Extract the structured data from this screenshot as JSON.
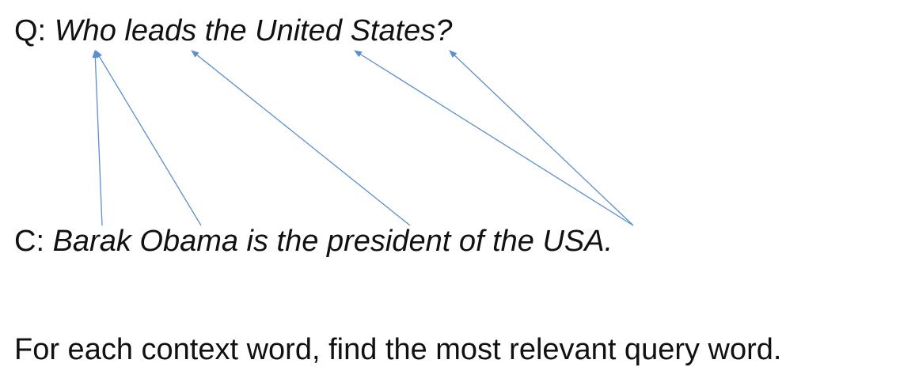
{
  "question": {
    "prefix": "Q: ",
    "text": "Who leads the United States?"
  },
  "context": {
    "prefix": "C: ",
    "text": "Barak Obama is the president of the USA."
  },
  "caption": "For each context word, find the most relevant query word.",
  "arrow_color": "#5b8fd0",
  "attention_links": [
    {
      "context_word": "Barak",
      "query_word": "Who"
    },
    {
      "context_word": "Obama",
      "query_word": "Who"
    },
    {
      "context_word": "president",
      "query_word": "leads"
    },
    {
      "context_word": "USA",
      "query_word": "United"
    },
    {
      "context_word": "USA",
      "query_word": "States"
    }
  ]
}
